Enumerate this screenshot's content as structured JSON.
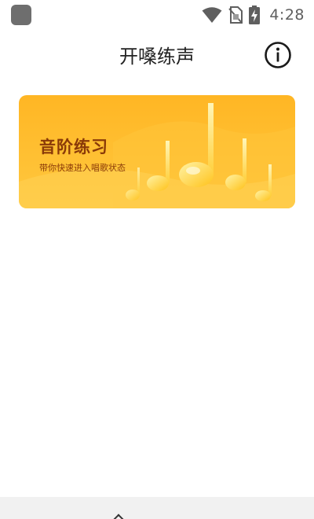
{
  "status_bar": {
    "time": "4:28",
    "icons": [
      "app-icon",
      "wifi-icon",
      "no-sim-icon",
      "battery-charging-icon"
    ]
  },
  "header": {
    "title": "开嗓练声",
    "info_icon": "info-icon"
  },
  "banner": {
    "title": "音阶练习",
    "subtitle": "带你快速进入唱歌状态",
    "colors": {
      "background_top": "#ffb624",
      "background_bottom": "#ffc83f",
      "text": "#8a3a08",
      "note": "#ffd24a"
    },
    "decoration": "music-notes-icon"
  },
  "colors": {
    "title_text": "#222222",
    "status_icons": "#5f5f5f",
    "bottom_nav_bg": "#f1f1f1"
  }
}
